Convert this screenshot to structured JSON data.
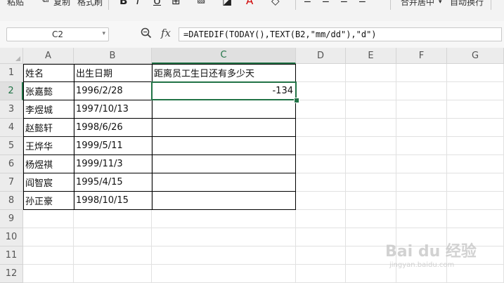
{
  "toolbar": {
    "paste_label": "粘贴",
    "copy_label": "复制",
    "format_painter_label": "格式刷",
    "merge_center_label": "合并居中",
    "wrap_text_label": "自动换行",
    "icons": [
      "bold-icon",
      "italic-icon",
      "underline-icon",
      "border-icon",
      "fill-color-icon",
      "font-color-icon",
      "clear-format-icon"
    ]
  },
  "formula_bar": {
    "name_box": "C2",
    "fx_label": "fx",
    "formula": "=DATEDIF(TODAY(),TEXT(B2,\"mm/dd\"),\"d\")"
  },
  "sheet": {
    "columns": [
      "A",
      "B",
      "C",
      "D",
      "E",
      "F",
      "G"
    ],
    "rows": [
      "1",
      "2",
      "3",
      "4",
      "5",
      "6",
      "7",
      "8",
      "9",
      "10",
      "11",
      "12"
    ],
    "active_cell": "C2",
    "headers": {
      "A1": "姓名",
      "B1": "出生日期",
      "C1": "距离员工生日还有多少天"
    },
    "data": [
      {
        "name": "张嘉懿",
        "birth": "1996/2/28",
        "days": "-134"
      },
      {
        "name": "李煜城",
        "birth": "1997/10/13",
        "days": ""
      },
      {
        "name": "赵懿轩",
        "birth": "1998/6/26",
        "days": ""
      },
      {
        "name": "王烨华",
        "birth": "1999/5/11",
        "days": ""
      },
      {
        "name": "杨煜祺",
        "birth": "1999/11/3",
        "days": ""
      },
      {
        "name": "阎智宸",
        "birth": "1995/4/15",
        "days": ""
      },
      {
        "name": "孙正豪",
        "birth": "1998/10/15",
        "days": ""
      }
    ]
  },
  "watermark": {
    "main": "Bai du 经验",
    "sub": "jingyan.baidu.com"
  },
  "colors": {
    "accent": "#217346"
  }
}
